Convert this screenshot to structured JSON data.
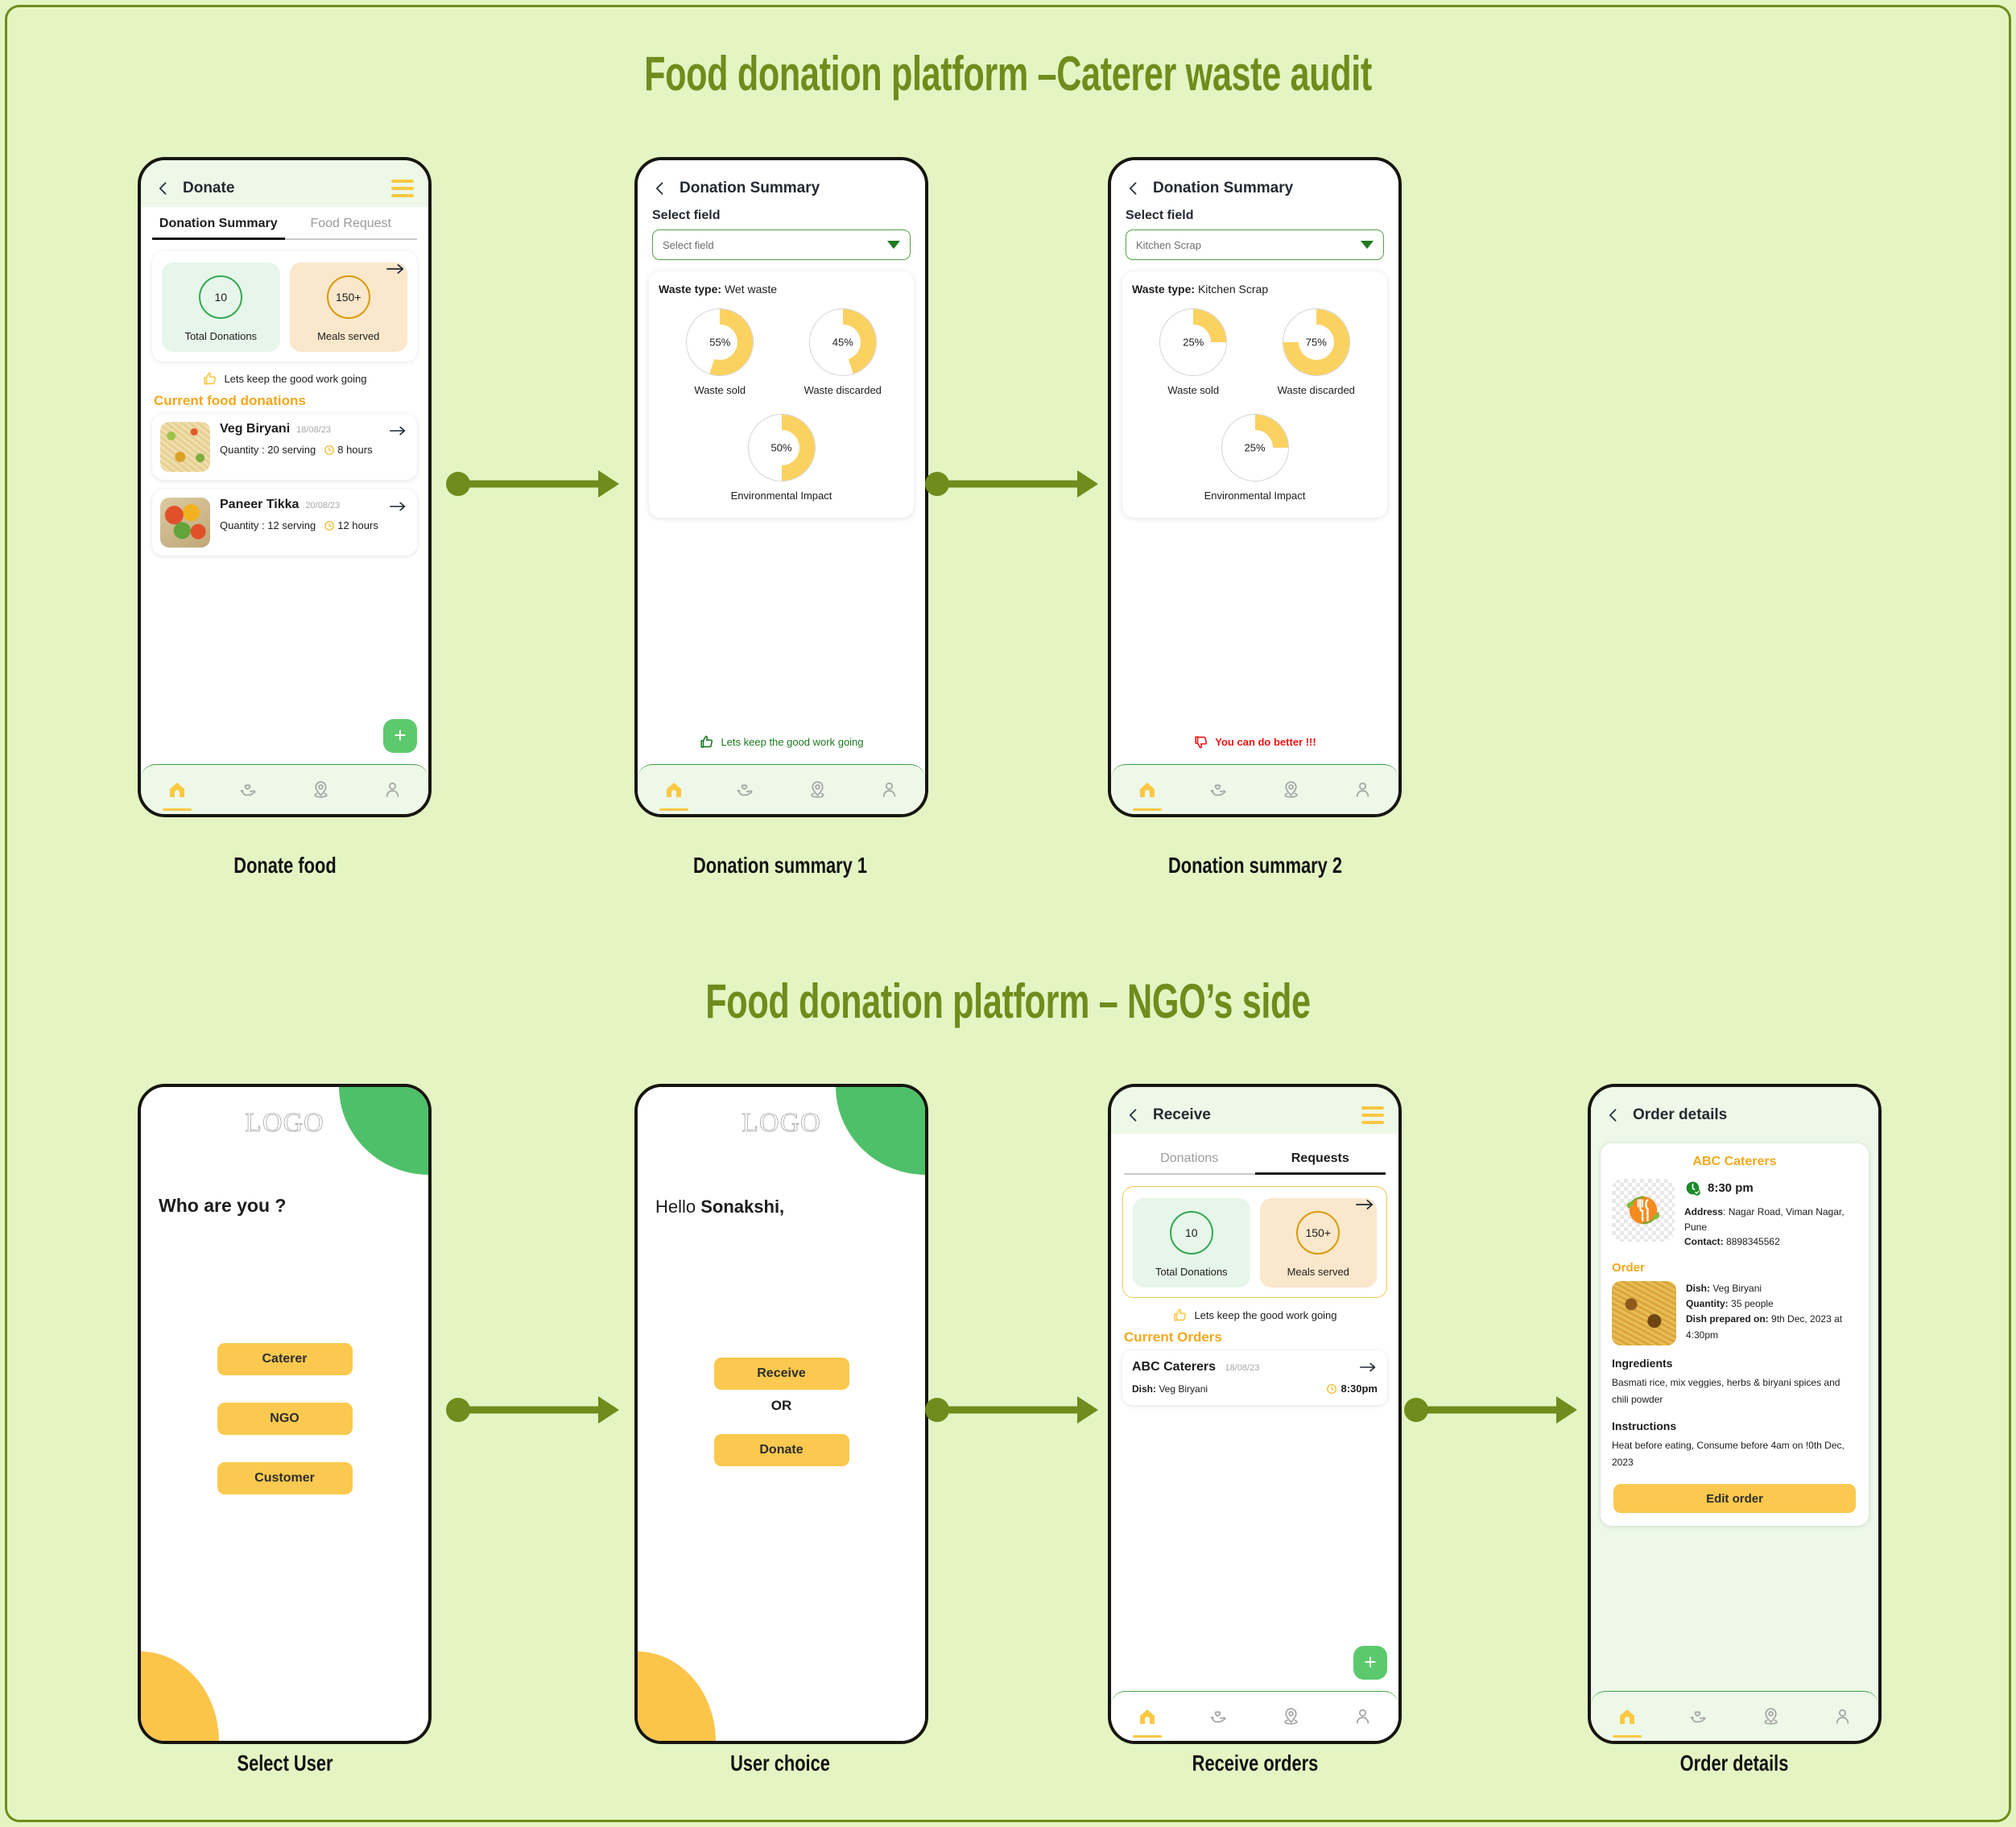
{
  "sections": [
    {
      "title": "Food donation platform  –Caterer waste audit"
    },
    {
      "title": "Food donation platform  – NGO’s side"
    }
  ],
  "colors": {
    "board_bg": "#e4f5c3",
    "olive": "#6f8c1c",
    "yellow": "#fbc94f",
    "green_accent": "#4fc06a",
    "orange_text": "#f4a81d",
    "red": "#f01414"
  },
  "captions": {
    "donate_food": "Donate food",
    "donation_summary_1": "Donation summary 1",
    "donation_summary_2": "Donation summary 2",
    "select_user": "Select User",
    "user_choice": "User choice",
    "receive_orders": "Receive orders",
    "order_details": "Order details"
  },
  "donate_screen": {
    "appbar_title": "Donate",
    "tabs": [
      {
        "label": "Donation Summary",
        "active": true
      },
      {
        "label": "Food Request",
        "active": false
      }
    ],
    "stats": [
      {
        "value": "10",
        "label": "Total Donations"
      },
      {
        "value": "150+",
        "label": "Meals served"
      }
    ],
    "encouragement": "Lets keep the good work going",
    "section_heading": "Current food donations",
    "items": [
      {
        "name": "Veg Biryani",
        "date": "18/08/23",
        "quantity": "Quantity : 20 serving",
        "time": "8 hours"
      },
      {
        "name": "Paneer Tikka",
        "date": "20/08/23",
        "quantity": "Quantity : 12 serving",
        "time": "12 hours"
      }
    ],
    "fab": "+"
  },
  "summary1": {
    "appbar_title": "Donation Summary",
    "field_label": "Select field",
    "select_value": "Select field",
    "waste_type_label": "Waste type:",
    "waste_type_value": "Wet waste",
    "encouragement": "Lets keep the good work going",
    "chart_data": {
      "type": "pie",
      "title": "Waste type: Wet waste",
      "categories": [
        "Waste sold",
        "Waste discarded",
        "Environmental Impact"
      ],
      "values": [
        55,
        45,
        50
      ],
      "unit": "%",
      "ylim": [
        0,
        100
      ],
      "legend": "none",
      "grid": false
    }
  },
  "summary2": {
    "appbar_title": "Donation Summary",
    "field_label": "Select field",
    "select_value": "Kitchen Scrap",
    "waste_type_label": "Waste type:",
    "waste_type_value": "Kitchen Scrap",
    "warning": "You can do better !!!",
    "chart_data": {
      "type": "pie",
      "title": "Waste type: Kitchen Scrap",
      "categories": [
        "Waste sold",
        "Waste discarded",
        "Environmental Impact"
      ],
      "values": [
        25,
        75,
        25
      ],
      "unit": "%",
      "ylim": [
        0,
        100
      ],
      "legend": "none",
      "grid": false
    }
  },
  "select_user": {
    "logo": "LOGO",
    "question": "Who are you ?",
    "buttons": [
      "Caterer",
      "NGO",
      "Customer"
    ]
  },
  "user_choice": {
    "logo": "LOGO",
    "greeting_prefix": "Hello ",
    "greeting_name": "Sonakshi,",
    "primary_button": "Receive",
    "divider": "OR",
    "secondary_button": "Donate"
  },
  "receive_screen": {
    "appbar_title": "Receive",
    "tabs": [
      {
        "label": "Donations",
        "active": false
      },
      {
        "label": "Requests",
        "active": true
      }
    ],
    "stats": [
      {
        "value": "10",
        "label": "Total Donations"
      },
      {
        "value": "150+",
        "label": "Meals served"
      }
    ],
    "encouragement": "Lets keep the good work going",
    "section_heading": "Current Orders",
    "order": {
      "caterer": "ABC Caterers",
      "date": "18/08/23",
      "dish_label": "Dish:",
      "dish_value": "Veg Biryani",
      "time": "8:30pm"
    },
    "fab": "+"
  },
  "order_details": {
    "appbar_title": "Order details",
    "caterer": "ABC Caterers",
    "time": "8:30 pm",
    "address_label": "Address",
    "address_value": ": Nagar Road, Viman Nagar, Pune",
    "contact_label": "Contact:",
    "contact_value": "8898345562",
    "order_heading": "Order",
    "dish_label": "Dish:",
    "dish_value": "Veg Biryani",
    "quantity_label": "Quantity:",
    "quantity_value": "35 people",
    "prepared_label": "Dish prepared on:",
    "prepared_value": "9th Dec, 2023 at 4:30pm",
    "ingredients_heading": "Ingredients",
    "ingredients_body": "Basmati rice, mix veggies, herbs & biryani spices and chili powder",
    "instructions_heading": "Instructions",
    "instructions_body": "Heat before eating, Consume before 4am on !0th Dec, 2023",
    "edit_button": "Edit order"
  }
}
